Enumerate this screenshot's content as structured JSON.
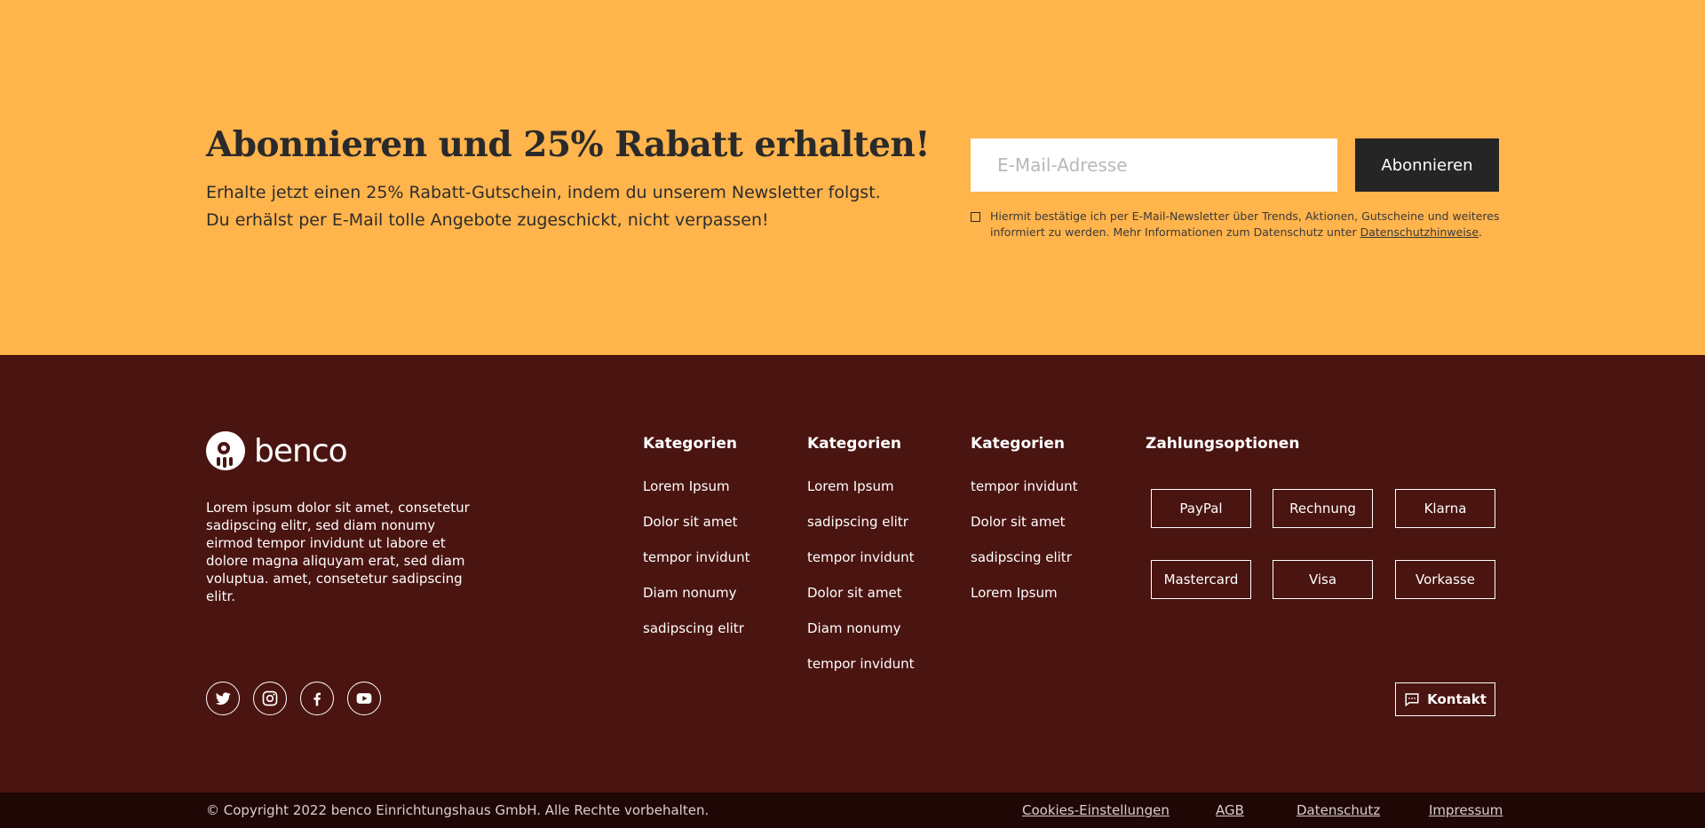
{
  "newsletter": {
    "title": "Abonnieren und 25% Rabatt erhalten!",
    "text_line1": "Erhalte jetzt einen 25% Rabatt-Gutschein, indem du unserem Newsletter folgst.",
    "text_line2": "Du erhälst per E-Mail tolle Angebote zugeschickt, nicht verpassen!",
    "email_placeholder": "E-Mail-Adresse",
    "email_value": "",
    "subscribe_label": "Abonnieren",
    "consent_text": "Hiermit bestätige ich per E-Mail-Newsletter über Trends, Aktionen, Gutscheine und weiteres informiert zu werden. Mehr Informationen zum Datenschutz unter ",
    "consent_link": "Datenschutzhinweise",
    "consent_end": "."
  },
  "footer": {
    "logo_text": "benco",
    "about": "Lorem ipsum dolor sit amet, consetetur sadipscing elitr, sed diam nonumy eirmod tempor invidunt ut labore et dolore magna aliquyam erat, sed diam voluptua.  amet, consetetur sadipscing elitr.",
    "columns": [
      {
        "title": "Kategorien",
        "items": [
          "Lorem Ipsum",
          "Dolor sit amet",
          "tempor invidunt",
          "Diam nonumy",
          "sadipscing elitr"
        ]
      },
      {
        "title": "Kategorien",
        "items": [
          "Lorem Ipsum",
          "sadipscing elitr",
          "tempor invidunt",
          "Dolor sit amet",
          "Diam nonumy",
          "tempor invidunt"
        ]
      },
      {
        "title": "Kategorien",
        "items": [
          "tempor invidunt",
          "Dolor sit amet",
          "sadipscing elitr",
          "Lorem Ipsum"
        ]
      }
    ],
    "payment": {
      "title": "Zahlungsoptionen",
      "options": [
        "PayPal",
        "Rechnung",
        "Klarna",
        "Mastercard",
        "Visa",
        "Vorkasse"
      ]
    },
    "social_icons": [
      "twitter-icon",
      "instagram-icon",
      "facebook-icon",
      "youtube-icon"
    ],
    "contact_label": "Kontakt"
  },
  "bottom": {
    "copyright": "© Copyright 2022 benco Einrichtungshaus GmbH. Alle Rechte vorbehalten.",
    "links": [
      "Cookies-Einstellungen",
      "AGB",
      "Datenschutz",
      "Impressum"
    ]
  },
  "colors": {
    "newsletter_bg": "#ffb44c",
    "footer_bg": "#4a1410",
    "bottom_bar_bg": "#1f0706",
    "button_dark": "#252525"
  }
}
